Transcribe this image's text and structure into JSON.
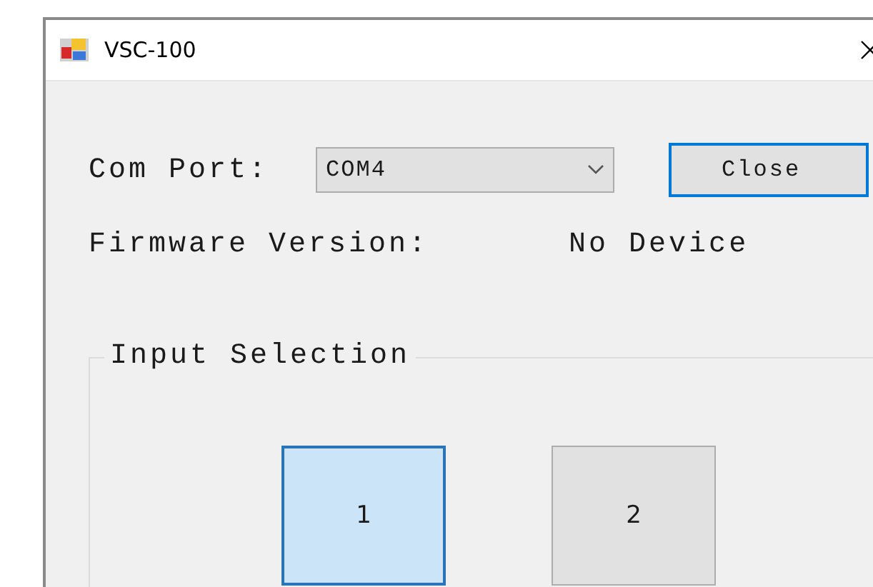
{
  "window": {
    "title": "VSC-100"
  },
  "com_port": {
    "label": "Com Port:",
    "value": "COM4"
  },
  "connect_button": {
    "label": "Close"
  },
  "firmware": {
    "label": "Firmware Version:",
    "value": "No Device"
  },
  "input_selection": {
    "title": "Input Selection",
    "inputs": [
      {
        "label": "1",
        "selected": true
      },
      {
        "label": "2",
        "selected": false
      }
    ]
  }
}
